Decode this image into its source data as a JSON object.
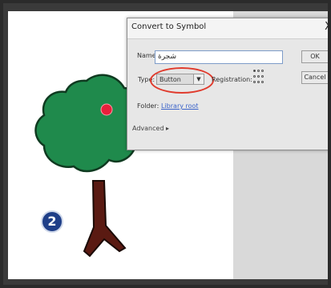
{
  "dialog": {
    "title": "Convert to Symbol",
    "close_label": "X",
    "name_label": "Name:",
    "name_value": "شجرة",
    "type_label": "Type:",
    "type_value": "Button",
    "registration_label": "Registration:",
    "folder_label": "Folder:",
    "folder_link": "Library root",
    "advanced_label": "Advanced ▸",
    "ok_label": "OK",
    "cancel_label": "Cancel",
    "highlight_color": "#e03b2d"
  },
  "stage": {
    "badge_number": "2",
    "tree_crown_color": "#1f8a4c",
    "tree_trunk_color": "#5a1a12",
    "apple_color": "#e81f3b"
  }
}
